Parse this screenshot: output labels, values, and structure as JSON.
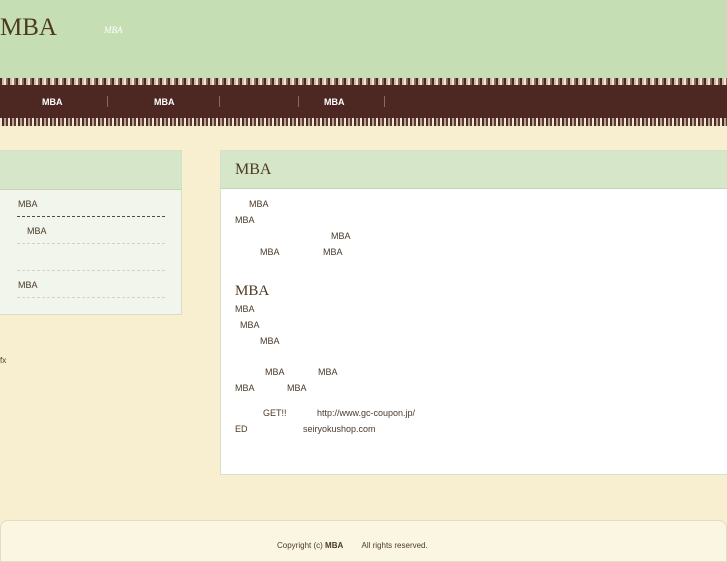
{
  "header": {
    "site_title": "MBA",
    "tagline": "MBA"
  },
  "nav": {
    "items": [
      "MBA",
      "MBA",
      "MBA"
    ]
  },
  "sidebar": {
    "items": [
      "MBA",
      "MBA",
      "MBA"
    ]
  },
  "side_misc": "fx",
  "main": {
    "title": "MBA",
    "section1_lines": [
      "MBA",
      "MBA",
      "MBA",
      "MBA",
      "MBA"
    ],
    "section2_title": "MBA",
    "section2_lines": [
      "MBA",
      "MBA",
      "MBA",
      "MBA",
      "MBA",
      "MBA",
      "MBA"
    ],
    "get_text": "GET!!",
    "link_url": "http://www.gc-coupon.jp/",
    "ed_text": "ED",
    "link_site": "seiryokushop.com"
  },
  "footer": {
    "copyright_prefix": "Copyright (c)",
    "copyright_name": "MBA",
    "copyright_suffix": "All rights reserved."
  }
}
